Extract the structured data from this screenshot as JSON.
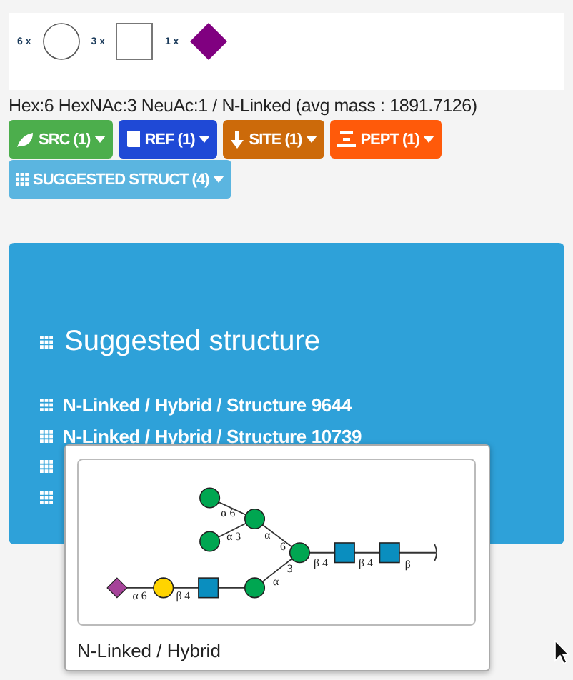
{
  "legend": [
    {
      "count": "6 x",
      "kind": "circle"
    },
    {
      "count": "3 x",
      "kind": "square"
    },
    {
      "count": "1 x",
      "kind": "diamond"
    }
  ],
  "composition": "Hex:6 HexNAc:3 NeuAc:1 / N-Linked (avg mass : 1891.7126)",
  "buttons": [
    {
      "label": "SRC (1)",
      "color": "#4cae4c"
    },
    {
      "label": "REF (1)",
      "color": "#1f49d6"
    },
    {
      "label": "SITE (1)",
      "color": "#cc6a0a"
    },
    {
      "label": "PEPT (1)",
      "color": "#ff5a0a"
    },
    {
      "label": "SUGGESTED STRUCT (4)",
      "color": "#5bb5e0"
    }
  ],
  "panel": {
    "title": "Suggested structure",
    "items": [
      {
        "kind": "link",
        "label": "N-Linked / Hybrid / Structure 9644"
      },
      {
        "kind": "link",
        "label": "N-Linked / Hybrid / Structure 10739"
      },
      {
        "kind": "covered"
      },
      {
        "kind": "covered"
      }
    ]
  },
  "popup": {
    "caption": "N-Linked / Hybrid",
    "linkages": [
      "α 6",
      "α 3",
      "α",
      "6",
      "β 4",
      "β 4",
      "β",
      "α",
      "3",
      "α 6",
      "β 4"
    ]
  }
}
